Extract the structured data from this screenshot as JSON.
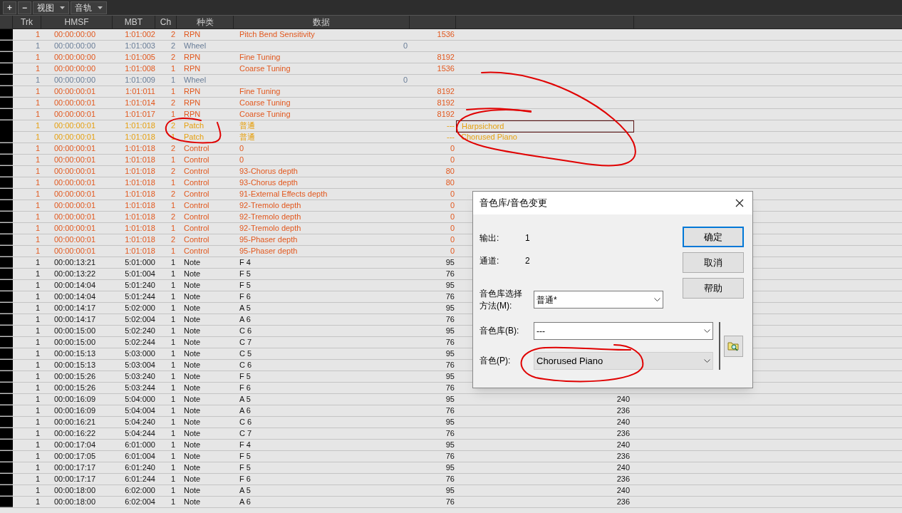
{
  "toolbar": [
    {
      "label": "+",
      "dropdown": false
    },
    {
      "label": "−",
      "dropdown": false
    },
    {
      "label": "视图",
      "dropdown": true
    },
    {
      "label": "音轨",
      "dropdown": true
    }
  ],
  "columns": [
    "Trk",
    "HMSF",
    "MBT",
    "Ch",
    "种类",
    "数据"
  ],
  "rows": [
    {
      "kind": "rpn",
      "trk": "1",
      "hmsf": "00:00:00:00",
      "mbt": "1:01:002",
      "ch": "2",
      "type": "RPN",
      "data": "Pitch Bend Sensitivity",
      "value": "1536"
    },
    {
      "kind": "wheel",
      "trk": "1",
      "hmsf": "00:00:00:00",
      "mbt": "1:01:003",
      "ch": "2",
      "type": "Wheel",
      "data": "0"
    },
    {
      "kind": "rpn",
      "trk": "1",
      "hmsf": "00:00:00:00",
      "mbt": "1:01:005",
      "ch": "2",
      "type": "RPN",
      "data": "Fine Tuning",
      "value": "8192"
    },
    {
      "kind": "rpn",
      "trk": "1",
      "hmsf": "00:00:00:00",
      "mbt": "1:01:008",
      "ch": "1",
      "type": "RPN",
      "data": "Coarse Tuning",
      "value": "1536"
    },
    {
      "kind": "wheel",
      "trk": "1",
      "hmsf": "00:00:00:00",
      "mbt": "1:01:009",
      "ch": "1",
      "type": "Wheel",
      "data": "0"
    },
    {
      "kind": "rpn",
      "trk": "1",
      "hmsf": "00:00:00:01",
      "mbt": "1:01:011",
      "ch": "1",
      "type": "RPN",
      "data": "Fine Tuning",
      "value": "8192"
    },
    {
      "kind": "rpn",
      "trk": "1",
      "hmsf": "00:00:00:01",
      "mbt": "1:01:014",
      "ch": "2",
      "type": "RPN",
      "data": "Coarse Tuning",
      "value": "8192"
    },
    {
      "kind": "rpn",
      "trk": "1",
      "hmsf": "00:00:00:01",
      "mbt": "1:01:017",
      "ch": "1",
      "type": "RPN",
      "data": "Coarse Tuning",
      "value": "8192"
    },
    {
      "kind": "patch",
      "trk": "1",
      "hmsf": "00:00:00:01",
      "mbt": "1:01:018",
      "ch": "2",
      "type": "Patch",
      "data": "普通",
      "value": "---",
      "extra": {
        "text": "Harpsichord",
        "selected": true
      }
    },
    {
      "kind": "patch",
      "trk": "1",
      "hmsf": "00:00:00:01",
      "mbt": "1:01:018",
      "ch": "1",
      "type": "Patch",
      "data": "普通",
      "value": "---",
      "extra": {
        "text": "Chorused Piano",
        "selected": false
      }
    },
    {
      "kind": "control",
      "trk": "1",
      "hmsf": "00:00:00:01",
      "mbt": "1:01:018",
      "ch": "2",
      "type": "Control",
      "data": "0",
      "value": "0"
    },
    {
      "kind": "control",
      "trk": "1",
      "hmsf": "00:00:00:01",
      "mbt": "1:01:018",
      "ch": "1",
      "type": "Control",
      "data": "0",
      "value": "0"
    },
    {
      "kind": "control",
      "trk": "1",
      "hmsf": "00:00:00:01",
      "mbt": "1:01:018",
      "ch": "2",
      "type": "Control",
      "data": "93-Chorus depth",
      "value": "80"
    },
    {
      "kind": "control",
      "trk": "1",
      "hmsf": "00:00:00:01",
      "mbt": "1:01:018",
      "ch": "1",
      "type": "Control",
      "data": "93-Chorus depth",
      "value": "80"
    },
    {
      "kind": "control",
      "trk": "1",
      "hmsf": "00:00:00:01",
      "mbt": "1:01:018",
      "ch": "2",
      "type": "Control",
      "data": "91-External Effects depth",
      "value": "0"
    },
    {
      "kind": "control",
      "trk": "1",
      "hmsf": "00:00:00:01",
      "mbt": "1:01:018",
      "ch": "1",
      "type": "Control",
      "data": "92-Tremolo depth",
      "value": "0"
    },
    {
      "kind": "control",
      "trk": "1",
      "hmsf": "00:00:00:01",
      "mbt": "1:01:018",
      "ch": "2",
      "type": "Control",
      "data": "92-Tremolo depth",
      "value": "0"
    },
    {
      "kind": "control",
      "trk": "1",
      "hmsf": "00:00:00:01",
      "mbt": "1:01:018",
      "ch": "1",
      "type": "Control",
      "data": "92-Tremolo depth",
      "value": "0"
    },
    {
      "kind": "control",
      "trk": "1",
      "hmsf": "00:00:00:01",
      "mbt": "1:01:018",
      "ch": "2",
      "type": "Control",
      "data": "95-Phaser depth",
      "value": "0"
    },
    {
      "kind": "control",
      "trk": "1",
      "hmsf": "00:00:00:01",
      "mbt": "1:01:018",
      "ch": "1",
      "type": "Control",
      "data": "95-Phaser depth",
      "value": "0"
    },
    {
      "kind": "note",
      "trk": "1",
      "hmsf": "00:00:13:21",
      "mbt": "5:01:000",
      "ch": "1",
      "type": "Note",
      "data": "F 4",
      "value": "95"
    },
    {
      "kind": "note",
      "trk": "1",
      "hmsf": "00:00:13:22",
      "mbt": "5:01:004",
      "ch": "1",
      "type": "Note",
      "data": "F 5",
      "value": "76"
    },
    {
      "kind": "note",
      "trk": "1",
      "hmsf": "00:00:14:04",
      "mbt": "5:01:240",
      "ch": "1",
      "type": "Note",
      "data": "F 5",
      "value": "95"
    },
    {
      "kind": "note",
      "trk": "1",
      "hmsf": "00:00:14:04",
      "mbt": "5:01:244",
      "ch": "1",
      "type": "Note",
      "data": "F 6",
      "value": "76"
    },
    {
      "kind": "note",
      "trk": "1",
      "hmsf": "00:00:14:17",
      "mbt": "5:02:000",
      "ch": "1",
      "type": "Note",
      "data": "A 5",
      "value": "95"
    },
    {
      "kind": "note",
      "trk": "1",
      "hmsf": "00:00:14:17",
      "mbt": "5:02:004",
      "ch": "1",
      "type": "Note",
      "data": "A 6",
      "value": "76"
    },
    {
      "kind": "note",
      "trk": "1",
      "hmsf": "00:00:15:00",
      "mbt": "5:02:240",
      "ch": "1",
      "type": "Note",
      "data": "C 6",
      "value": "95"
    },
    {
      "kind": "note",
      "trk": "1",
      "hmsf": "00:00:15:00",
      "mbt": "5:02:244",
      "ch": "1",
      "type": "Note",
      "data": "C 7",
      "value": "76"
    },
    {
      "kind": "note",
      "trk": "1",
      "hmsf": "00:00:15:13",
      "mbt": "5:03:000",
      "ch": "1",
      "type": "Note",
      "data": "C 5",
      "value": "95"
    },
    {
      "kind": "note",
      "trk": "1",
      "hmsf": "00:00:15:13",
      "mbt": "5:03:004",
      "ch": "1",
      "type": "Note",
      "data": "C 6",
      "value": "76"
    },
    {
      "kind": "note",
      "trk": "1",
      "hmsf": "00:00:15:26",
      "mbt": "5:03:240",
      "ch": "1",
      "type": "Note",
      "data": "F 5",
      "value": "95"
    },
    {
      "kind": "note",
      "trk": "1",
      "hmsf": "00:00:15:26",
      "mbt": "5:03:244",
      "ch": "1",
      "type": "Note",
      "data": "F 6",
      "value": "76"
    },
    {
      "kind": "note",
      "trk": "1",
      "hmsf": "00:00:16:09",
      "mbt": "5:04:000",
      "ch": "1",
      "type": "Note",
      "data": "A 5",
      "value": "95",
      "duration": "240"
    },
    {
      "kind": "note",
      "trk": "1",
      "hmsf": "00:00:16:09",
      "mbt": "5:04:004",
      "ch": "1",
      "type": "Note",
      "data": "A 6",
      "value": "76",
      "duration": "236"
    },
    {
      "kind": "note",
      "trk": "1",
      "hmsf": "00:00:16:21",
      "mbt": "5:04:240",
      "ch": "1",
      "type": "Note",
      "data": "C 6",
      "value": "95",
      "duration": "240"
    },
    {
      "kind": "note",
      "trk": "1",
      "hmsf": "00:00:16:22",
      "mbt": "5:04:244",
      "ch": "1",
      "type": "Note",
      "data": "C 7",
      "value": "76",
      "duration": "236"
    },
    {
      "kind": "note",
      "trk": "1",
      "hmsf": "00:00:17:04",
      "mbt": "6:01:000",
      "ch": "1",
      "type": "Note",
      "data": "F 4",
      "value": "95",
      "duration": "240"
    },
    {
      "kind": "note",
      "trk": "1",
      "hmsf": "00:00:17:05",
      "mbt": "6:01:004",
      "ch": "1",
      "type": "Note",
      "data": "F 5",
      "value": "76",
      "duration": "236"
    },
    {
      "kind": "note",
      "trk": "1",
      "hmsf": "00:00:17:17",
      "mbt": "6:01:240",
      "ch": "1",
      "type": "Note",
      "data": "F 5",
      "value": "95",
      "duration": "240"
    },
    {
      "kind": "note",
      "trk": "1",
      "hmsf": "00:00:17:17",
      "mbt": "6:01:244",
      "ch": "1",
      "type": "Note",
      "data": "F 6",
      "value": "76",
      "duration": "236"
    },
    {
      "kind": "note",
      "trk": "1",
      "hmsf": "00:00:18:00",
      "mbt": "6:02:000",
      "ch": "1",
      "type": "Note",
      "data": "A 5",
      "value": "95",
      "duration": "240"
    },
    {
      "kind": "note",
      "trk": "1",
      "hmsf": "00:00:18:00",
      "mbt": "6:02:004",
      "ch": "1",
      "type": "Note",
      "data": "A 6",
      "value": "76",
      "duration": "236"
    }
  ],
  "dialog": {
    "title": "音色库/音色变更",
    "info": [
      {
        "label": "输出:",
        "value": "1"
      },
      {
        "label": "通道:",
        "value": "2"
      }
    ],
    "selects": [
      {
        "label": "音色库选择方法(M):",
        "value": "普通*",
        "focused": false
      },
      {
        "label": "音色库(B):",
        "value": "---",
        "focused": false
      },
      {
        "label": "音色(P):",
        "value": "Chorused Piano",
        "focused": true
      }
    ],
    "buttons": [
      {
        "label": "确定",
        "default": true
      },
      {
        "label": "取消",
        "default": false
      },
      {
        "label": "帮助",
        "default": false
      }
    ]
  }
}
